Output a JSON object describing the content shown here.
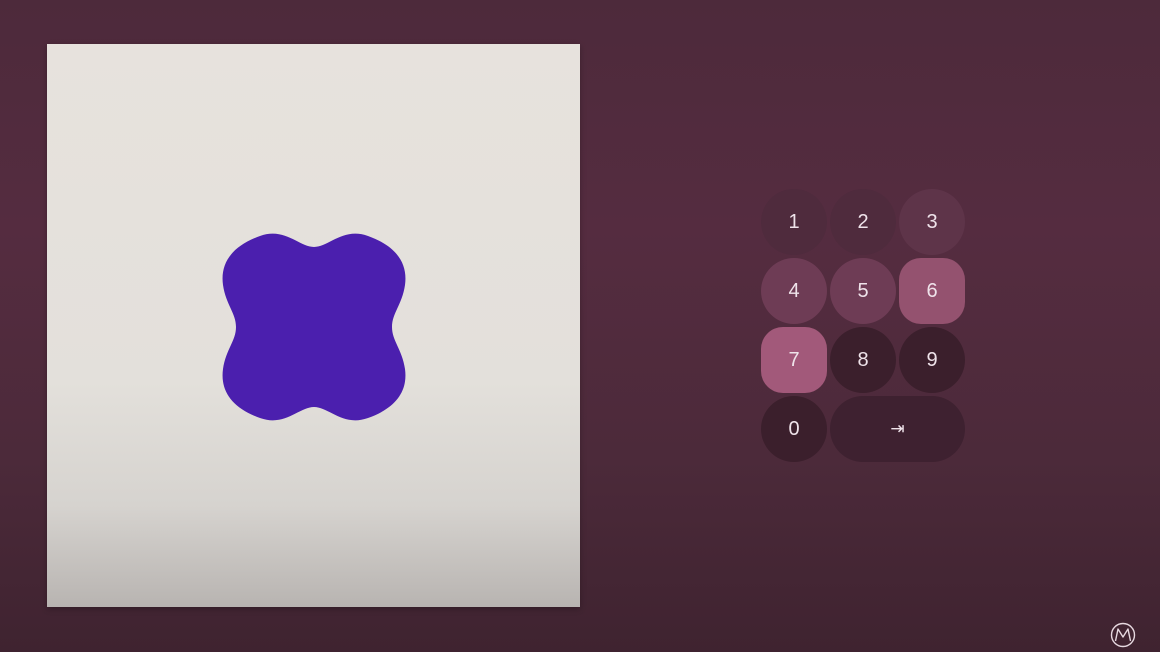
{
  "canvas": {
    "background_color": "#e5e1dc",
    "shape_name": "four-lobed-blob-shape",
    "shape_color": "#4b1fae"
  },
  "keypad": {
    "keys": [
      "1",
      "2",
      "3",
      "4",
      "5",
      "6",
      "7",
      "8",
      "9",
      "0"
    ],
    "enter_label": "⇥"
  },
  "colors": {
    "background": "#4f2a3d",
    "key_default": "#4f2b3d",
    "key_highlight": "#a2597a"
  },
  "logo_icon": "m-circle-logo-icon"
}
